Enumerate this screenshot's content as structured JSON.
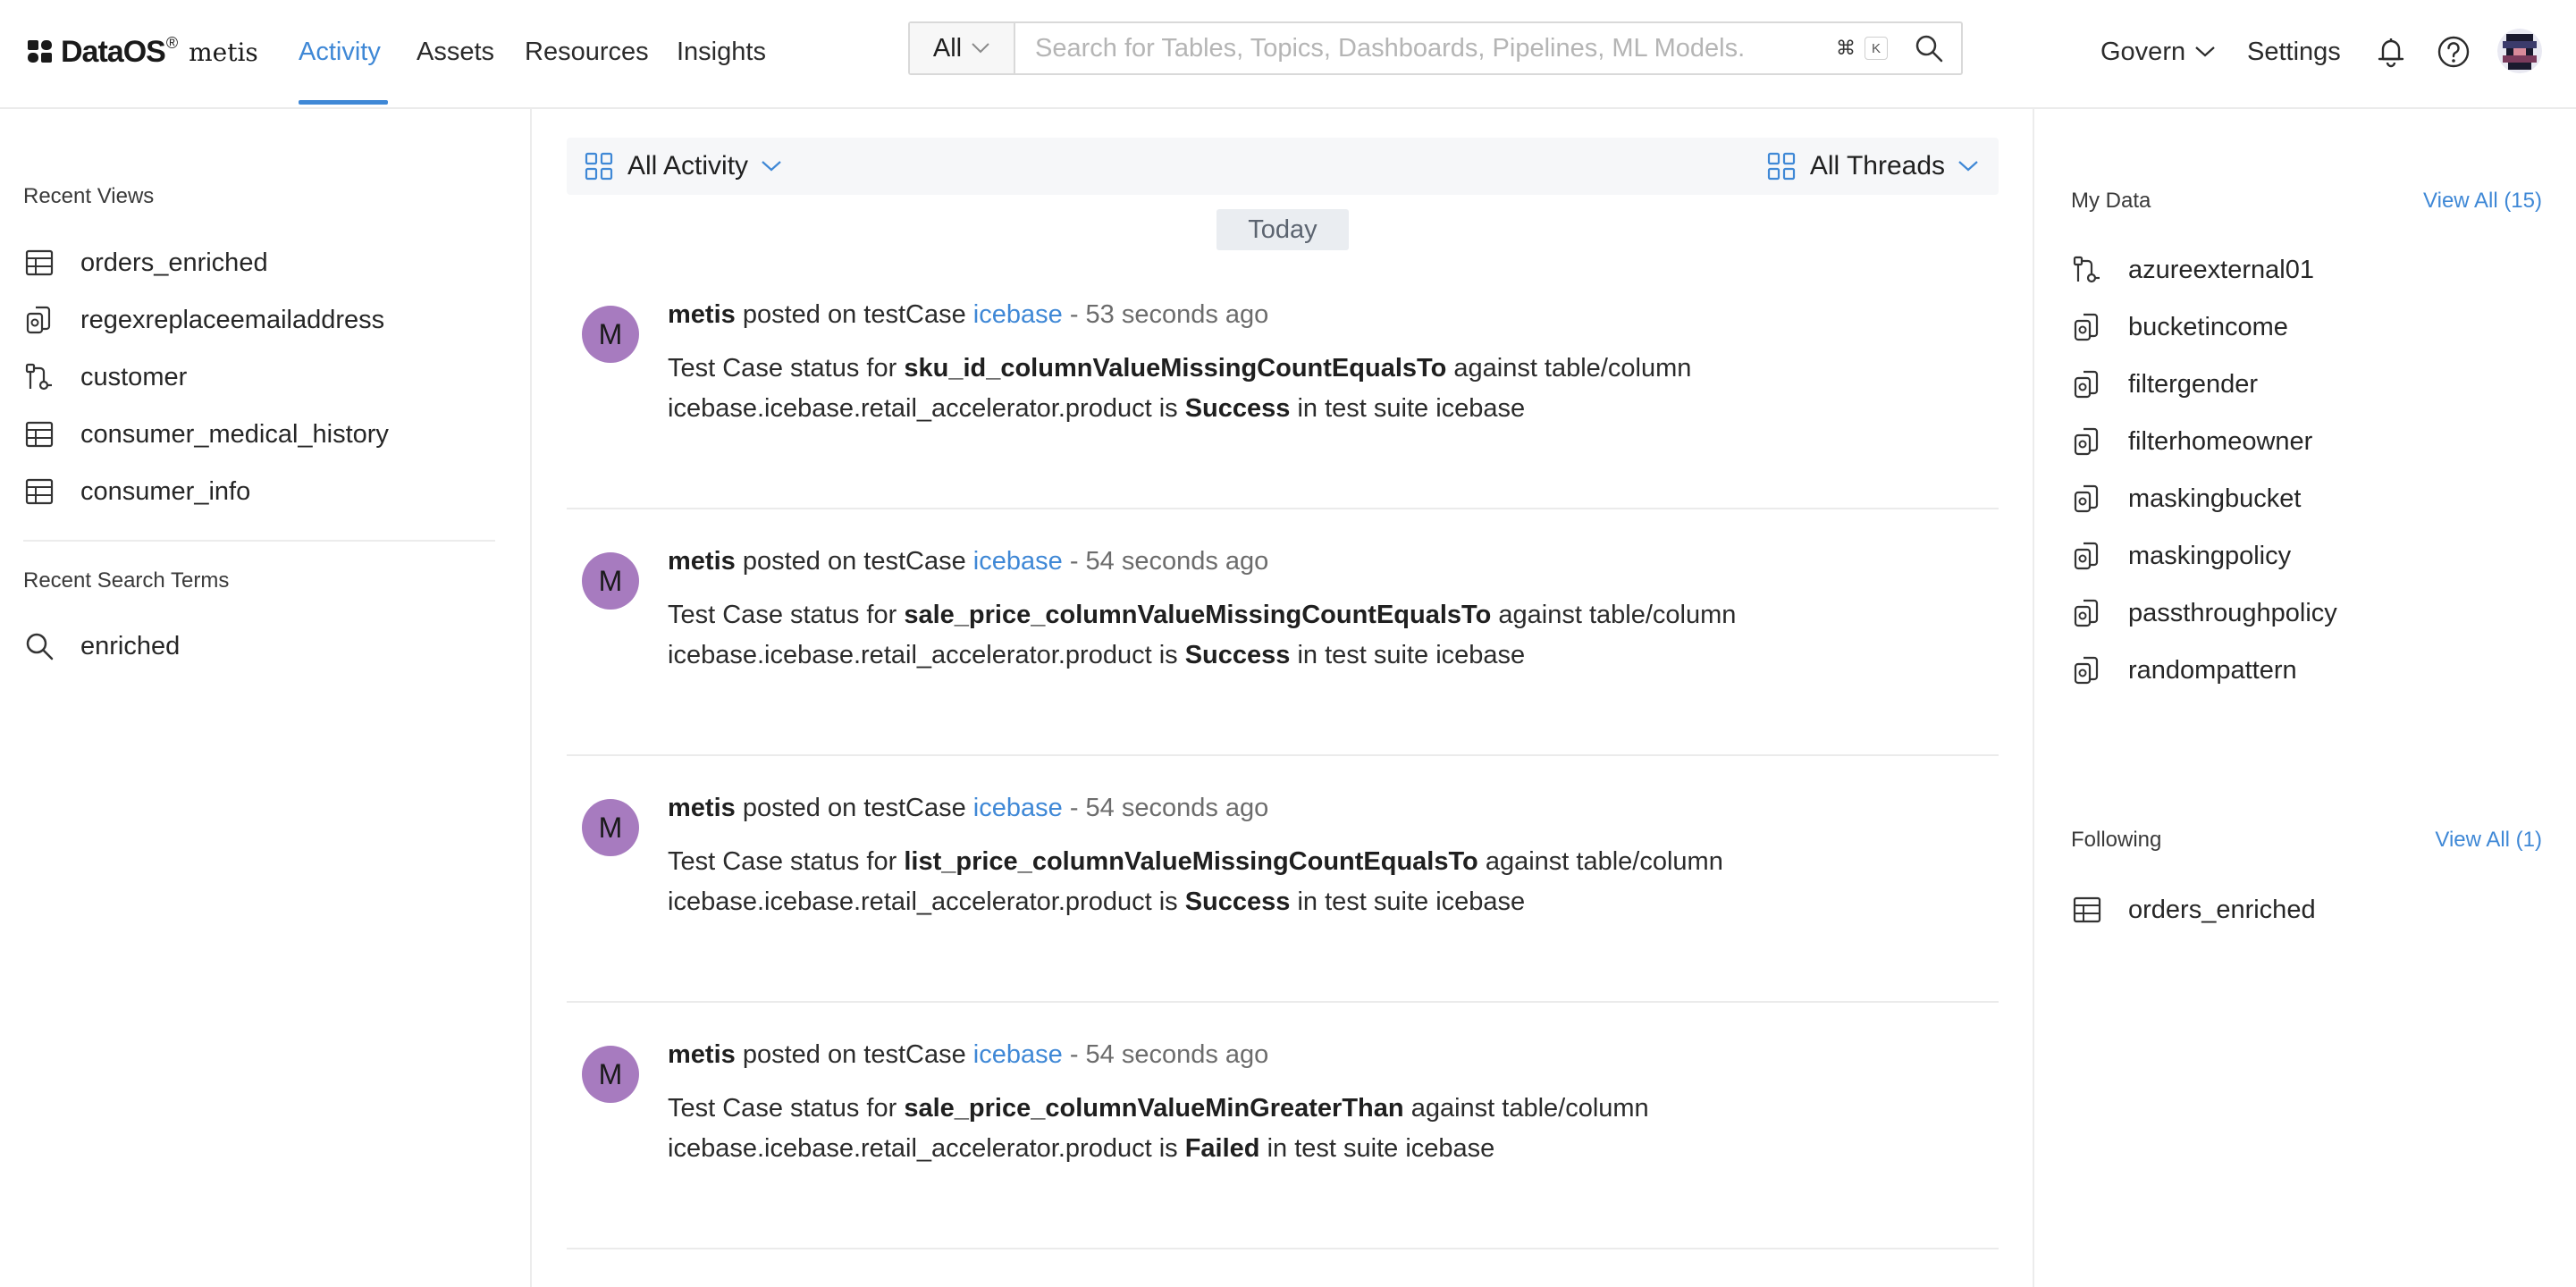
{
  "app": {
    "brand": "DataOS",
    "brand_sup": "®",
    "brand_sub": "metis"
  },
  "nav": {
    "tabs": [
      {
        "label": "Activity",
        "active": true
      },
      {
        "label": "Assets",
        "active": false
      },
      {
        "label": "Resources",
        "active": false
      },
      {
        "label": "Insights",
        "active": false
      }
    ],
    "accent": "#3f88d6"
  },
  "search": {
    "type_label": "All",
    "placeholder": "Search for Tables, Topics, Dashboards, Pipelines, ML Models.",
    "value": "",
    "shortcut_cmd": "⌘",
    "shortcut_key": "K"
  },
  "right_nav": {
    "govern": "Govern",
    "settings": "Settings"
  },
  "left": {
    "recent_views_title": "Recent Views",
    "recent_views": [
      {
        "label": "orders_enriched",
        "icon": "table-icon"
      },
      {
        "label": "regexreplaceemailaddress",
        "icon": "policy-icon"
      },
      {
        "label": "customer",
        "icon": "pipeline-icon"
      },
      {
        "label": "consumer_medical_history",
        "icon": "table-icon"
      },
      {
        "label": "consumer_info",
        "icon": "table-icon"
      }
    ],
    "recent_search_title": "Recent Search Terms",
    "recent_searches": [
      {
        "label": "enriched",
        "icon": "search-icon"
      }
    ]
  },
  "feed": {
    "filter_left": "All Activity",
    "filter_right": "All Threads",
    "date_label": "Today",
    "posts": [
      {
        "avatar": "M",
        "author": "metis",
        "action": "posted on testCase",
        "entity": "icebase",
        "time": "- 53 seconds ago",
        "prefix": "Test Case status for",
        "test": "sku_id_columnValueMissingCountEqualsTo",
        "middle": "against table/column icebase.icebase.retail_accelerator.product is",
        "status": "Success",
        "suffix": "in test suite icebase"
      },
      {
        "avatar": "M",
        "author": "metis",
        "action": "posted on testCase",
        "entity": "icebase",
        "time": "- 54 seconds ago",
        "prefix": "Test Case status for",
        "test": "sale_price_columnValueMissingCountEqualsTo",
        "middle": "against table/column icebase.icebase.retail_accelerator.product is",
        "status": "Success",
        "suffix": "in test suite icebase"
      },
      {
        "avatar": "M",
        "author": "metis",
        "action": "posted on testCase",
        "entity": "icebase",
        "time": "- 54 seconds ago",
        "prefix": "Test Case status for",
        "test": "list_price_columnValueMissingCountEqualsTo",
        "middle": "against table/column icebase.icebase.retail_accelerator.product is",
        "status": "Success",
        "suffix": "in test suite icebase"
      },
      {
        "avatar": "M",
        "author": "metis",
        "action": "posted on testCase",
        "entity": "icebase",
        "time": "- 54 seconds ago",
        "prefix": "Test Case status for",
        "test": "sale_price_columnValueMinGreaterThan",
        "middle": "against table/column icebase.icebase.retail_accelerator.product is",
        "status": "Failed",
        "suffix": "in test suite icebase"
      }
    ]
  },
  "right": {
    "my_data_title": "My Data",
    "my_data_view_all": "View All (15)",
    "my_data": [
      {
        "label": "azureexternal01",
        "icon": "pipeline-icon"
      },
      {
        "label": "bucketincome",
        "icon": "policy-icon"
      },
      {
        "label": "filtergender",
        "icon": "policy-icon"
      },
      {
        "label": "filterhomeowner",
        "icon": "policy-icon"
      },
      {
        "label": "maskingbucket",
        "icon": "policy-icon"
      },
      {
        "label": "maskingpolicy",
        "icon": "policy-icon"
      },
      {
        "label": "passthroughpolicy",
        "icon": "policy-icon"
      },
      {
        "label": "randompattern",
        "icon": "policy-icon"
      }
    ],
    "following_title": "Following",
    "following_view_all": "View All (1)",
    "following": [
      {
        "label": "orders_enriched",
        "icon": "table-icon"
      }
    ]
  }
}
